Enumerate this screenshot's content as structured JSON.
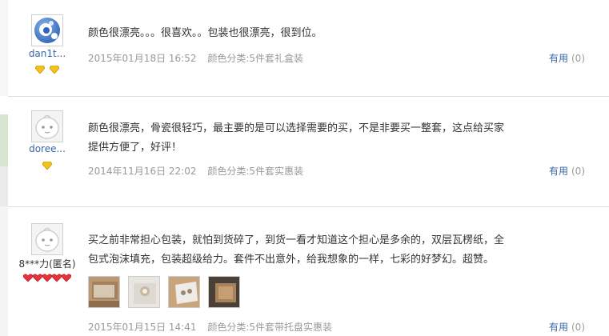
{
  "reviews": [
    {
      "username": "dan1t...",
      "content": "颜色很漂亮。。。很喜欢。。包装也很漂亮，很到位。",
      "date": "2015年01月18日 16:52",
      "variant": "颜色分类:5件套礼盒装",
      "useful_label": "有用",
      "useful_count": "(0)",
      "badge_icon": "yellow-diamond-icon",
      "badge_count": 2
    },
    {
      "username": "doree...",
      "content": "颜色很漂亮，骨瓷很轻巧，最主要的是可以选择需要的买，不是非要买一整套，这点给买家提供方便了，好评！",
      "date": "2014年11月16日 22:02",
      "variant": "颜色分类:5件套实惠装",
      "useful_label": "有用",
      "useful_count": "(0)",
      "badge_icon": "yellow-diamond-icon",
      "badge_count": 1
    },
    {
      "username": "8***力(匿名)",
      "content": "买之前非常担心包装，就怕到货碎了，到货一看才知道这个担心是多余的，双层瓦楞纸，全包式泡沫填充，包装超级给力。套件不出意外，给我想象的一样，七彩的好梦幻。超赞。",
      "date": "2015年01月15日 14:41",
      "variant": "颜色分类:5件套带托盘实惠装",
      "useful_label": "有用",
      "useful_count": "(0)",
      "badge_icon": "red-heart-icon",
      "badge_count": 5,
      "photo_count": 4
    }
  ],
  "colors": {
    "link": "#3566a8",
    "text": "#333333",
    "meta": "#999999"
  }
}
